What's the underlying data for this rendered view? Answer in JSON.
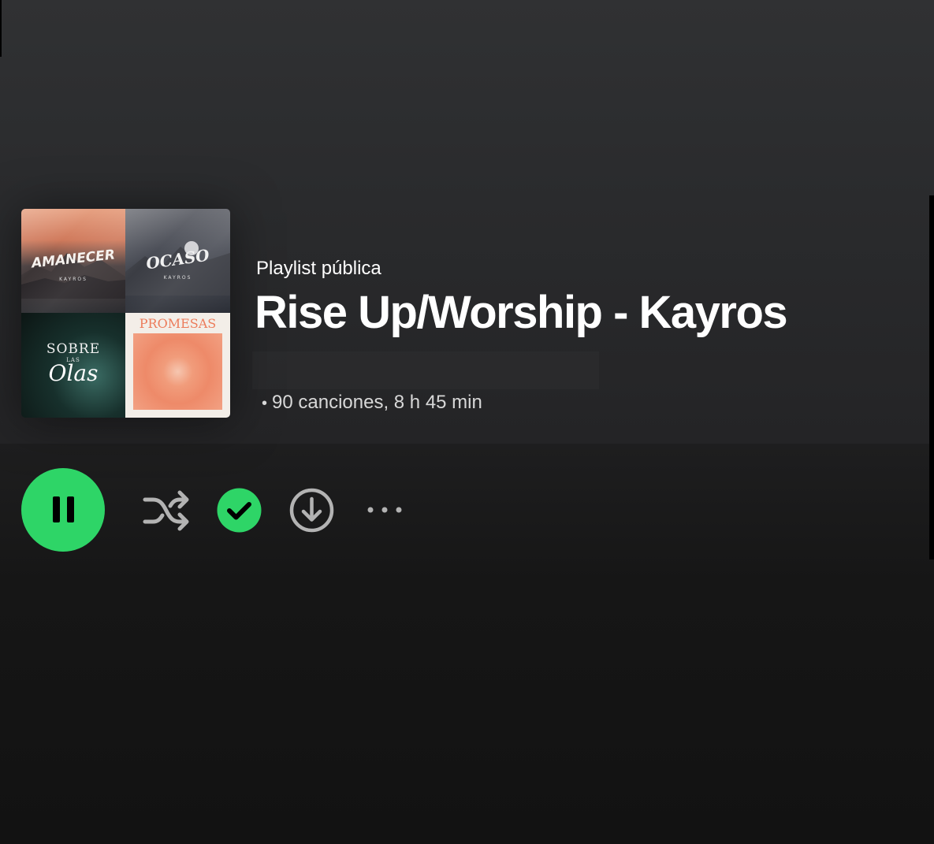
{
  "header": {
    "type_label": "Playlist pública",
    "title": "Rise Up/Worship - Kayros",
    "meta_dot": "•",
    "meta_stats": "90 canciones, 8 h 45 min"
  },
  "cover": {
    "tiles": [
      {
        "title": "AMANECER",
        "subtitle": "KAYROS"
      },
      {
        "title": "OCASO",
        "subtitle": "KAYROS"
      },
      {
        "title_line1": "SOBRE",
        "title_line2": "LAS",
        "title_line3": "Olas"
      },
      {
        "title": "PROMESAS"
      }
    ]
  },
  "actions": {
    "play_state": "playing",
    "play_icon": "pause-icon",
    "shuffle_icon": "shuffle-icon",
    "saved_icon": "check-circle-icon",
    "download_icon": "download-icon",
    "more_icon": "more-icon"
  },
  "colors": {
    "accent": "#2ed567",
    "header_bg": "#2c2d2f",
    "body_bg": "#121212",
    "icon_gray": "#b3b3b3"
  }
}
